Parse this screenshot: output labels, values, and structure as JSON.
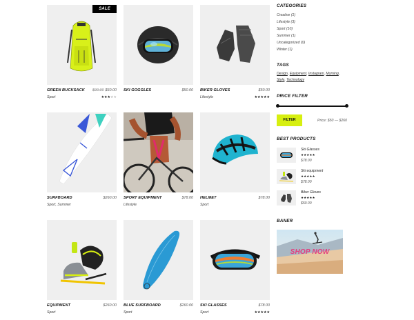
{
  "products": [
    {
      "name": "GREEN BUCKSACK",
      "category": "Sport",
      "old_price": "$90.00",
      "price": "$60.00",
      "badge": "SALE",
      "stars": "★★★",
      "stars_off": "★★",
      "rating": 3
    },
    {
      "name": "SKI GOGGLES",
      "category": "",
      "price": "$50.00",
      "stars": "",
      "stars_off": "",
      "rating": 0
    },
    {
      "name": "BIKER GLOVES",
      "category": "Lifestyle",
      "price": "$50.00",
      "stars": "★★★★★",
      "stars_off": "",
      "rating": 5
    },
    {
      "name": "SURFBOARD",
      "category": "Sport, Summer",
      "price": "$260.00",
      "stars": "",
      "stars_off": "",
      "rating": 0
    },
    {
      "name": "SPORT EQUIPMENT",
      "category": "Lifestyle",
      "price": "$78.00",
      "stars": "",
      "stars_off": "",
      "rating": 0
    },
    {
      "name": "HELMET",
      "category": "Sport",
      "price": "$78.00",
      "stars": "",
      "stars_off": "",
      "rating": 0
    },
    {
      "name": "EQUIPMENT",
      "category": "Sport",
      "price": "$260.00",
      "stars": "",
      "stars_off": "",
      "rating": 0
    },
    {
      "name": "BLUE SURFBOARD",
      "category": "Sport",
      "price": "$260.00",
      "stars": "",
      "stars_off": "",
      "rating": 0
    },
    {
      "name": "SKI GLASSES",
      "category": "Sport",
      "price": "$78.00",
      "stars": "★★★★★",
      "stars_off": "",
      "rating": 5
    }
  ],
  "sidebar": {
    "categories_title": "CATEGORIES",
    "categories": [
      "Creative (1)",
      "Lifestyle (3)",
      "Sport (10)",
      "Summer (1)",
      "Uncategorized (0)",
      "Winter (1)"
    ],
    "tags_title": "TAGS",
    "tags_line1": [
      "Design",
      "Equipment",
      "Instagram",
      "Morning"
    ],
    "tags_line2": [
      "Style",
      "Technology"
    ],
    "price_filter_title": "PRICE FILTER",
    "filter_button": "FILTER",
    "price_range": "Price: $50 — $260",
    "best_title": "BEST PRODUCTS",
    "best": [
      {
        "name": "Ski Glasses",
        "stars": "★★★★★",
        "price": "$78.00"
      },
      {
        "name": "Ski equipment",
        "stars": "★★★★★",
        "price": "$78.00"
      },
      {
        "name": "Biker Gloves",
        "stars": "★★★★★",
        "price": "$50.00"
      }
    ],
    "banner_title": "BANER",
    "banner_text": "SHOP NOW"
  },
  "colors": {
    "accent": "#d7ef10",
    "banner_text": "#e43b7d",
    "tile_bg": "#efefef"
  }
}
